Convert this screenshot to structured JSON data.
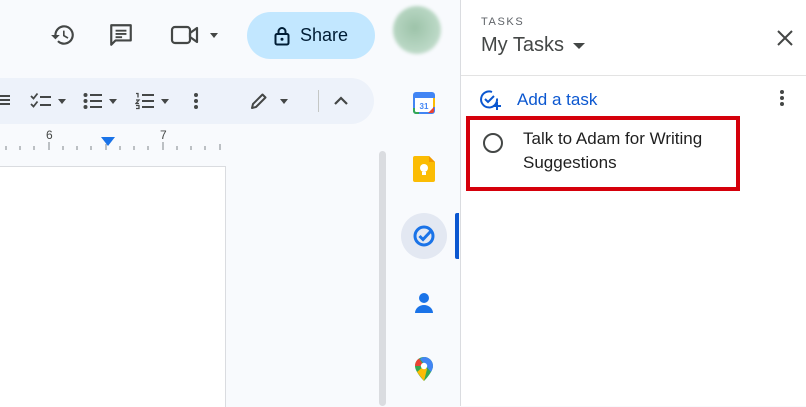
{
  "header": {
    "share_label": "Share",
    "icons": [
      "history-icon",
      "comment-icon",
      "meet-icon",
      "lock-icon"
    ]
  },
  "ruler": {
    "marks": [
      "6",
      "7"
    ]
  },
  "tasks_panel": {
    "kicker": "TASKS",
    "title": "My Tasks",
    "add_task_label": "Add a task",
    "tasks": [
      {
        "text": "Talk to Adam for Writing Suggestions",
        "completed": false
      }
    ]
  },
  "side_rail": {
    "items": [
      "calendar-icon",
      "keep-icon",
      "tasks-icon",
      "contacts-icon",
      "maps-icon"
    ],
    "active": "tasks-icon",
    "calendar_day": "31"
  },
  "colors": {
    "accent": "#0b57d0",
    "share_bg": "#c2e7ff",
    "highlight": "#d5000b"
  }
}
